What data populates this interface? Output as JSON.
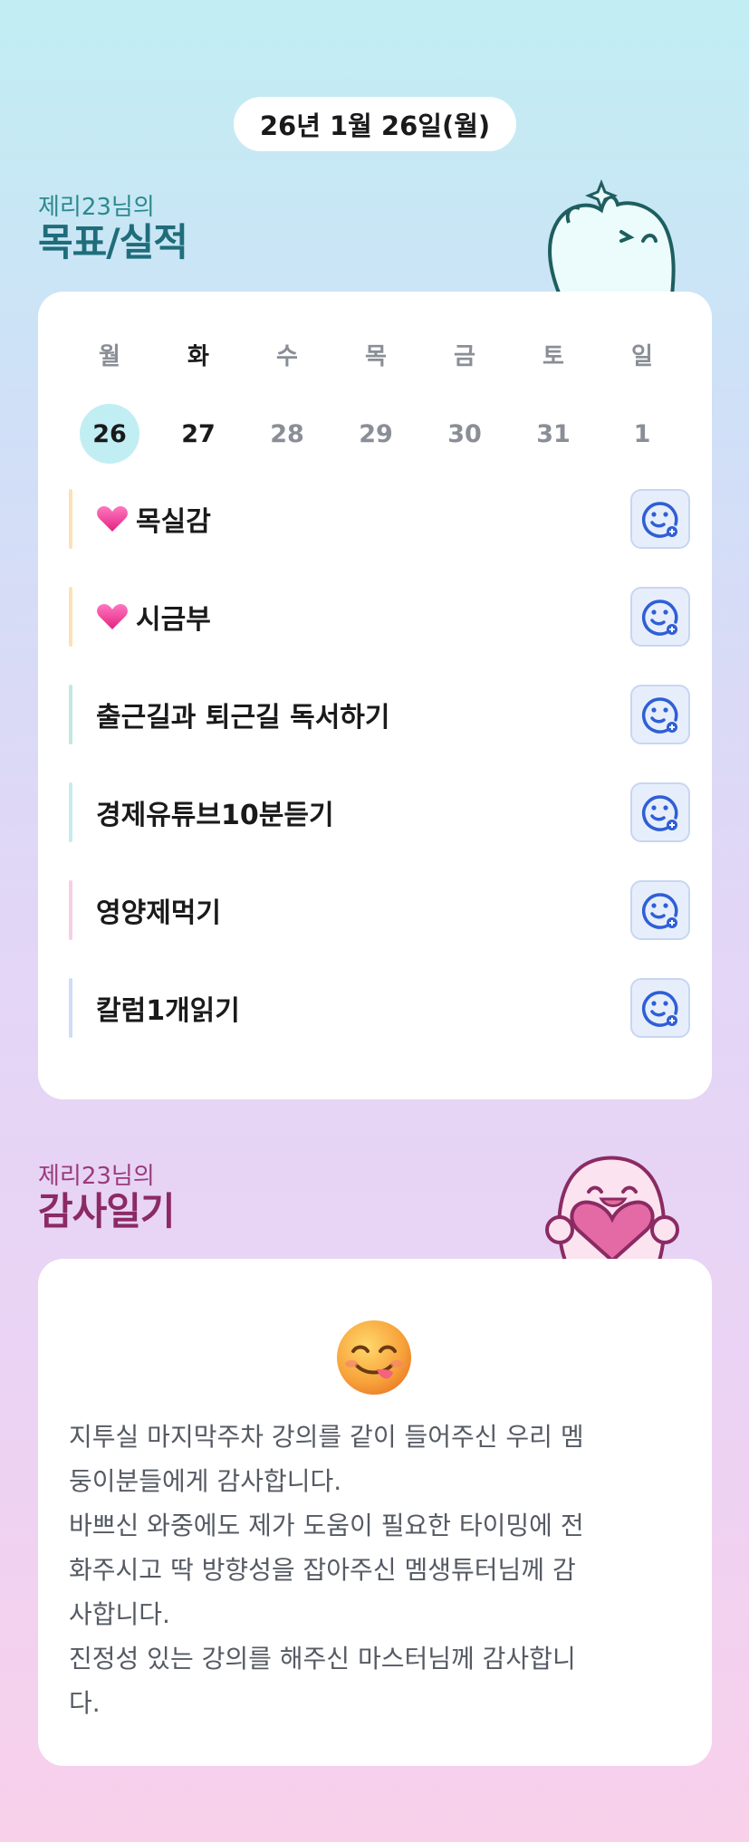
{
  "header": {
    "date": "26년 1월 26일(월)"
  },
  "goals_section": {
    "subtitle": "제리23님의",
    "title": "목표/실적"
  },
  "week": {
    "days": [
      "월",
      "화",
      "수",
      "목",
      "금",
      "토",
      "일"
    ],
    "dates": [
      "26",
      "27",
      "28",
      "29",
      "30",
      "31",
      "1"
    ],
    "selected_index": 0,
    "today_index": 1
  },
  "goals": [
    {
      "label": "목실감",
      "bar_color": "#fde1b5",
      "heart": true
    },
    {
      "label": "시금부",
      "bar_color": "#fde1b5",
      "heart": true
    },
    {
      "label": "출근길과 퇴근길 독서하기",
      "bar_color": "#bfe9df",
      "heart": false
    },
    {
      "label": "경제유튜브10분듣기",
      "bar_color": "#c5ecef",
      "heart": false
    },
    {
      "label": "영양제먹기",
      "bar_color": "#f7cfe3",
      "heart": false
    },
    {
      "label": "칼럼1개읽기",
      "bar_color": "#cfdcf8",
      "heart": false
    }
  ],
  "gratitude_section": {
    "subtitle": "제리23님의",
    "title": "감사일기"
  },
  "gratitude": {
    "emoji": "yum-face-emoji",
    "lines": [
      "지투실 마지막주차 강의를 같이 들어주신 우리 멤",
      "둥이분들에게 감사합니다.",
      "바쁘신 와중에도 제가 도움이 필요한 타이밍에 전",
      "화주시고 딱 방향성을 잡아주신 멤생튜터님께 감",
      "사합니다.",
      "진정성 있는 강의를 해주신 마스터님께 감사합니",
      "다."
    ]
  },
  "colors": {
    "accent_teal": "#1f6d7a",
    "accent_magenta": "#8b2a63",
    "selected_date_bg": "#c1eef3",
    "smile_icon": "#2f5fd6"
  }
}
